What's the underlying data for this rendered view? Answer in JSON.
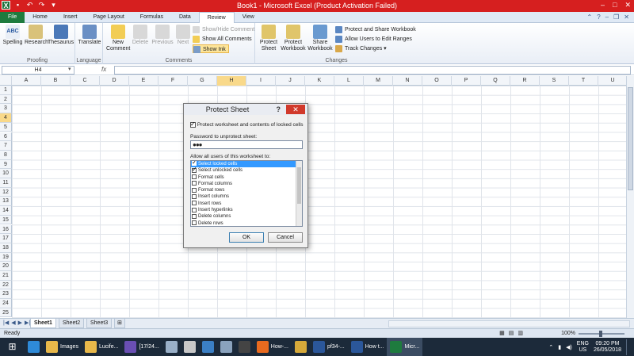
{
  "window": {
    "title": "Book1  -  Microsoft Excel (Product Activation Failed)",
    "excel_logo": "X",
    "minimize": "–",
    "maximize": "□",
    "close": "✕"
  },
  "ribbon_tabs": [
    "File",
    "Home",
    "Insert",
    "Page Layout",
    "Formulas",
    "Data",
    "Review",
    "View"
  ],
  "ribbon": {
    "proofing": {
      "label": "Proofing",
      "spelling": "Spelling",
      "research": "Research",
      "thesaurus": "Thesaurus"
    },
    "language": {
      "label": "Language",
      "translate": "Translate"
    },
    "comments": {
      "label": "Comments",
      "new_comment": "New Comment",
      "delete": "Delete",
      "previous": "Previous",
      "next": "Next",
      "show_hide": "Show/Hide Comment",
      "show_all": "Show All Comments",
      "show_ink": "Show Ink"
    },
    "changes": {
      "label": "Changes",
      "protect_sheet": "Protect Sheet",
      "protect_workbook": "Protect Workbook",
      "share_workbook": "Share Workbook",
      "protect_share": "Protect and Share Workbook",
      "allow_users": "Allow Users to Edit Ranges",
      "track_changes": "Track Changes"
    }
  },
  "formula_bar": {
    "name_box": "H4",
    "fx": "fx",
    "value": ""
  },
  "grid": {
    "columns": [
      "A",
      "B",
      "C",
      "D",
      "E",
      "F",
      "G",
      "H",
      "I",
      "J",
      "K",
      "L",
      "M",
      "N",
      "O",
      "P",
      "Q",
      "R",
      "S",
      "T",
      "U"
    ],
    "rows": [
      "1",
      "2",
      "3",
      "4",
      "5",
      "6",
      "7",
      "8",
      "9",
      "10",
      "11",
      "12",
      "13",
      "14",
      "15",
      "16",
      "17",
      "18",
      "19",
      "20",
      "21",
      "22",
      "23",
      "24",
      "25"
    ],
    "active_column": "H",
    "active_row": "4"
  },
  "sheets": [
    "Sheet1",
    "Sheet2",
    "Sheet3"
  ],
  "status": {
    "text": "Ready",
    "zoom": "100%"
  },
  "dialog": {
    "title": "Protect Sheet",
    "help": "?",
    "close": "✕",
    "protect_label": "Protect worksheet and contents of locked cells",
    "protect_checked": true,
    "password_label": "Password to unprotect sheet:",
    "password_value": "●●●",
    "allow_label": "Allow all users of this worksheet to:",
    "permissions": [
      {
        "label": "Select locked cells",
        "checked": true,
        "selected": true
      },
      {
        "label": "Select unlocked cells",
        "checked": true,
        "selected": false
      },
      {
        "label": "Format cells",
        "checked": false,
        "selected": false
      },
      {
        "label": "Format columns",
        "checked": false,
        "selected": false
      },
      {
        "label": "Format rows",
        "checked": false,
        "selected": false
      },
      {
        "label": "Insert columns",
        "checked": false,
        "selected": false
      },
      {
        "label": "Insert rows",
        "checked": false,
        "selected": false
      },
      {
        "label": "Insert hyperlinks",
        "checked": false,
        "selected": false
      },
      {
        "label": "Delete columns",
        "checked": false,
        "selected": false
      },
      {
        "label": "Delete rows",
        "checked": false,
        "selected": false
      }
    ],
    "ok": "OK",
    "cancel": "Cancel"
  },
  "taskbar": {
    "items": [
      {
        "label": "Images",
        "icon": "folder-icon",
        "color": "#e8b84a"
      },
      {
        "label": "Lucife...",
        "icon": "folder-icon",
        "color": "#e8b84a"
      },
      {
        "label": "[17/24...",
        "icon": "media-player-icon",
        "color": "#6a4fb3"
      },
      {
        "label": "",
        "icon": "screenshot-tool-icon",
        "color": "#9ab0c8"
      },
      {
        "label": "",
        "icon": "app-icon",
        "color": "#c8c8c8"
      },
      {
        "label": "",
        "icon": "notes-icon",
        "color": "#3b7fc4"
      },
      {
        "label": "",
        "icon": "calculator-icon",
        "color": "#8aa2bd"
      },
      {
        "label": "",
        "icon": "pen-icon",
        "color": "#444"
      },
      {
        "label": "How-...",
        "icon": "firefox-icon",
        "color": "#e86a1f"
      },
      {
        "label": "",
        "icon": "chrome-icon",
        "color": "#d6a93a"
      },
      {
        "label": "pf34-...",
        "icon": "word-icon",
        "color": "#2b579a"
      },
      {
        "label": "How t...",
        "icon": "word-icon",
        "color": "#2b579a"
      },
      {
        "label": "Micr...",
        "icon": "excel-icon",
        "color": "#1e7b3e"
      }
    ],
    "lang": "ENG",
    "region": "US",
    "time": "09:20 PM",
    "date": "26/05/2018"
  }
}
